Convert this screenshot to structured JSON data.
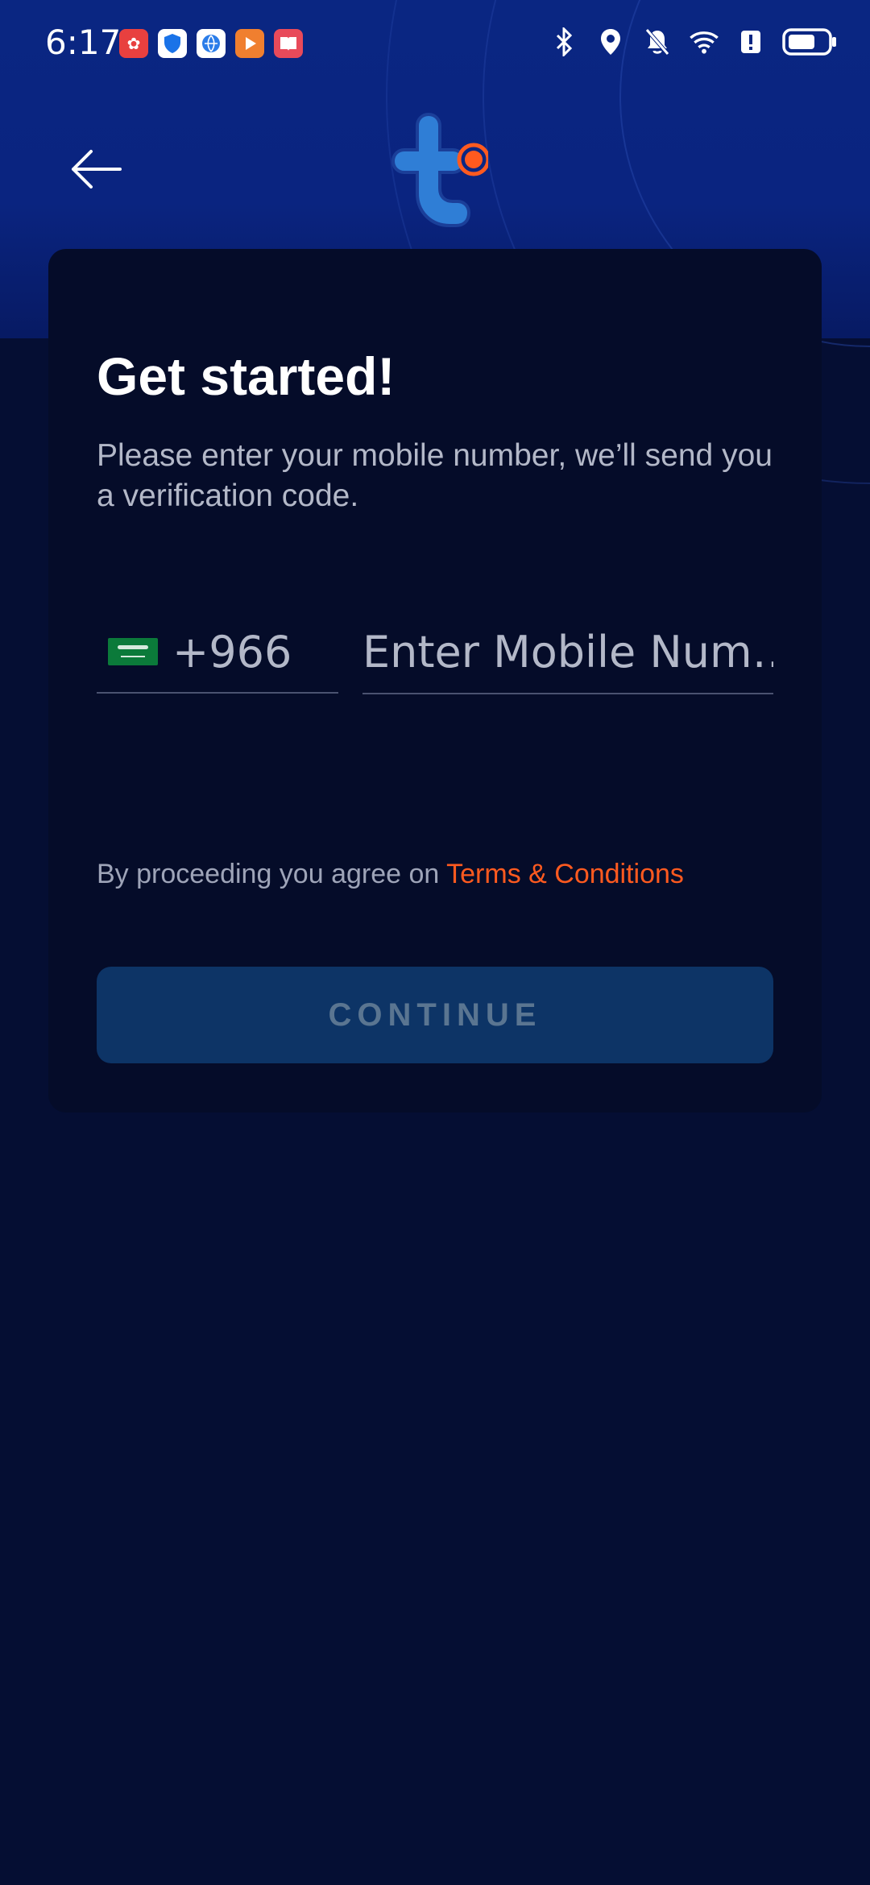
{
  "status_bar": {
    "time": "6:17",
    "app_icons": [
      "huawei-icon",
      "shield-app-icon",
      "browser-app-icon",
      "video-app-icon",
      "book-app-icon"
    ],
    "system_icons": [
      "bluetooth-icon",
      "location-icon",
      "mute-bell-icon",
      "wifi-icon",
      "alert-icon",
      "battery-icon"
    ]
  },
  "header": {
    "back_icon": "arrow-left-icon",
    "logo": "app-logo"
  },
  "card": {
    "title": "Get started!",
    "subtitle": "Please enter your mobile number, we’ll send you a verification code.",
    "country_code": "+966",
    "country_flag": "saudi-arabia-flag",
    "mobile_placeholder": "Enter Mobile Num…",
    "mobile_value": "",
    "terms_prefix": "By proceeding you agree on ",
    "terms_link": "Terms & Conditions",
    "continue_label": "CONTINUE"
  },
  "colors": {
    "background": "#050e33",
    "header_blue": "#0a2682",
    "card": "#050c29",
    "accent_orange": "#ff5a1f",
    "button_disabled": "#0d3466",
    "button_text_disabled": "#5a7591",
    "muted_text": "#b3b8c8"
  }
}
